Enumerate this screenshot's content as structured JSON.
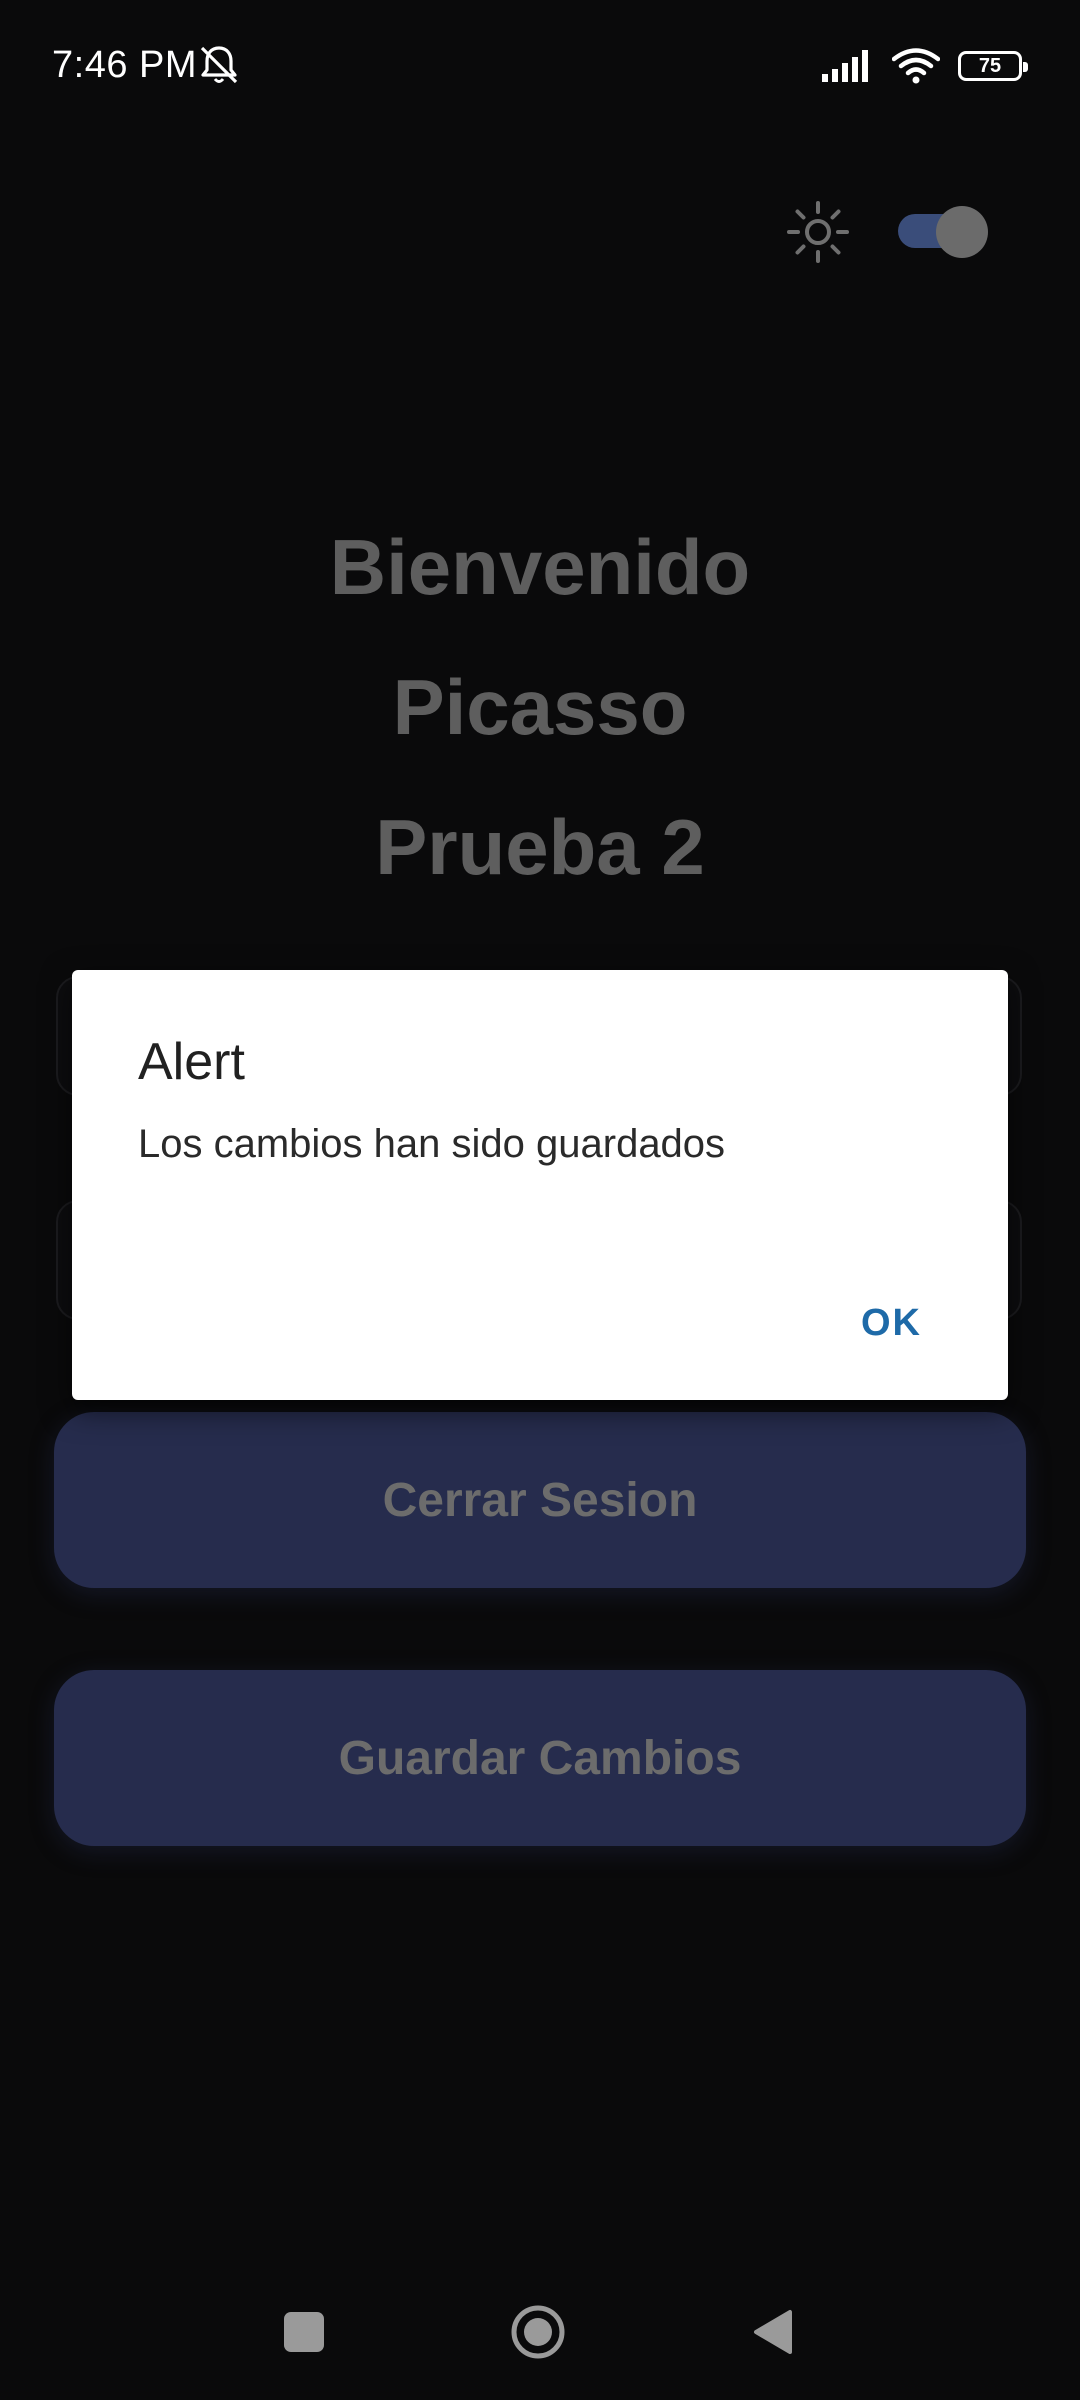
{
  "status_bar": {
    "time": "7:46 PM",
    "battery": "75",
    "icons": [
      "mute-icon",
      "signal-icon",
      "wifi-icon",
      "battery-icon"
    ]
  },
  "top_controls": {
    "theme_icon": "sun-icon",
    "dark_mode_on": true
  },
  "welcome": {
    "line1": "Bienvenido",
    "line2": "Picasso",
    "line3": "Prueba 2"
  },
  "buttons": {
    "logout": "Cerrar Sesion",
    "save": "Guardar Cambios"
  },
  "dialog": {
    "title": "Alert",
    "message": "Los cambios han sido guardados",
    "ok": "OK"
  },
  "colors": {
    "background": "#0a0a0b",
    "button_bg": "#262c4d",
    "dialog_ok": "#1e6aa8",
    "toggle_track": "#3a4d7a"
  },
  "nav_bar": {
    "icons": [
      "recent-apps-icon",
      "home-icon",
      "back-icon"
    ]
  }
}
